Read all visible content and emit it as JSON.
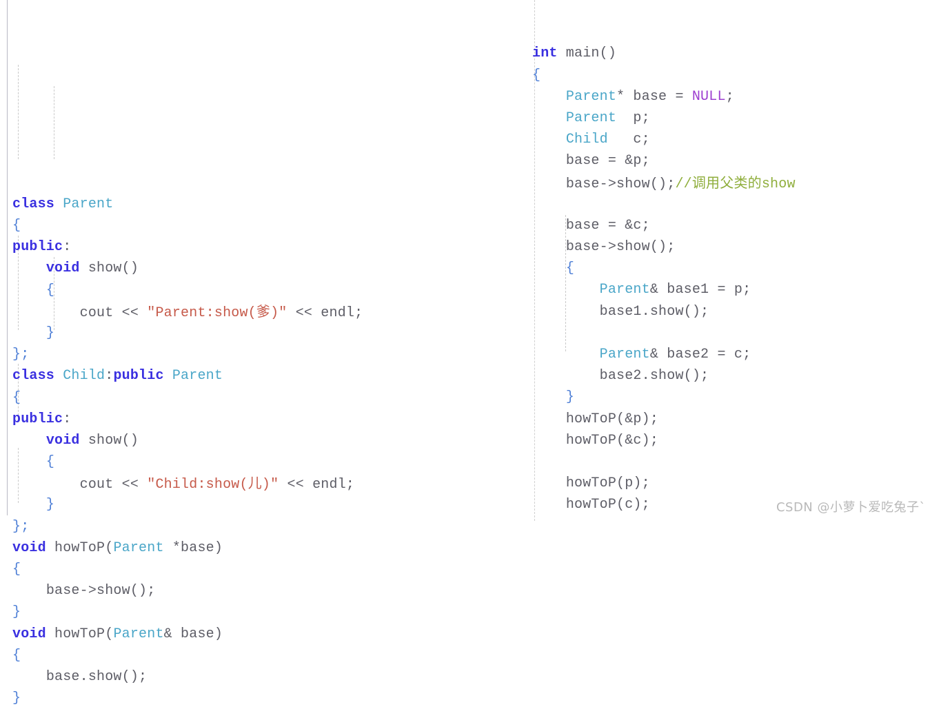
{
  "watermark": {
    "text": "CSDN @小萝卜爱吃兔子`"
  },
  "colors": {
    "background": "#ffffff",
    "keyword": "#3a30e0",
    "type": "#4aa6c8",
    "plain": "#5d5d66",
    "string": "#c65a4a",
    "comment": "#8fae3c",
    "macro": "#9d3fd0",
    "brace": "#4e7fd6",
    "guide": "#c9c9c9",
    "watermark": "#b9b9b9"
  },
  "left_pane": {
    "lines": [
      {
        "indent": 0,
        "tokens": [
          {
            "t": "class",
            "c": "kw"
          },
          {
            "t": " ",
            "c": "plain"
          },
          {
            "t": "Parent",
            "c": "type"
          }
        ]
      },
      {
        "indent": 0,
        "tokens": [
          {
            "t": "{",
            "c": "brace"
          }
        ]
      },
      {
        "indent": 0,
        "tokens": [
          {
            "t": "public",
            "c": "kw"
          },
          {
            "t": ":",
            "c": "plain"
          }
        ]
      },
      {
        "indent": 1,
        "tokens": [
          {
            "t": "void",
            "c": "kw"
          },
          {
            "t": " show()",
            "c": "plain"
          }
        ]
      },
      {
        "indent": 1,
        "tokens": [
          {
            "t": "{",
            "c": "brace"
          }
        ]
      },
      {
        "indent": 2,
        "tokens": [
          {
            "t": "cout << ",
            "c": "plain"
          },
          {
            "t": "\"Parent:show(",
            "c": "str"
          },
          {
            "t": "爹",
            "c": "str-cjk"
          },
          {
            "t": ")\"",
            "c": "str"
          },
          {
            "t": " << endl;",
            "c": "plain"
          }
        ]
      },
      {
        "indent": 1,
        "tokens": [
          {
            "t": "}",
            "c": "brace"
          }
        ]
      },
      {
        "indent": 0,
        "tokens": [
          {
            "t": "};",
            "c": "brace"
          }
        ]
      },
      {
        "indent": 0,
        "tokens": [
          {
            "t": "class",
            "c": "kw"
          },
          {
            "t": " ",
            "c": "plain"
          },
          {
            "t": "Child",
            "c": "type"
          },
          {
            "t": ":",
            "c": "plain"
          },
          {
            "t": "public",
            "c": "kw"
          },
          {
            "t": " ",
            "c": "plain"
          },
          {
            "t": "Parent",
            "c": "type"
          }
        ]
      },
      {
        "indent": 0,
        "tokens": [
          {
            "t": "{",
            "c": "brace"
          }
        ]
      },
      {
        "indent": 0,
        "tokens": [
          {
            "t": "public",
            "c": "kw"
          },
          {
            "t": ":",
            "c": "plain"
          }
        ]
      },
      {
        "indent": 1,
        "tokens": [
          {
            "t": "void",
            "c": "kw"
          },
          {
            "t": " show()",
            "c": "plain"
          }
        ]
      },
      {
        "indent": 1,
        "tokens": [
          {
            "t": "{",
            "c": "brace"
          }
        ]
      },
      {
        "indent": 2,
        "tokens": [
          {
            "t": "cout << ",
            "c": "plain"
          },
          {
            "t": "\"Child:show(",
            "c": "str"
          },
          {
            "t": "儿",
            "c": "str-cjk"
          },
          {
            "t": ")\"",
            "c": "str"
          },
          {
            "t": " << endl;",
            "c": "plain"
          }
        ]
      },
      {
        "indent": 1,
        "tokens": [
          {
            "t": "}",
            "c": "brace"
          }
        ]
      },
      {
        "indent": 0,
        "tokens": [
          {
            "t": "};",
            "c": "brace"
          }
        ]
      },
      {
        "indent": 0,
        "tokens": [
          {
            "t": "void",
            "c": "kw"
          },
          {
            "t": " howToP(",
            "c": "plain"
          },
          {
            "t": "Parent",
            "c": "type"
          },
          {
            "t": " *base)",
            "c": "plain"
          }
        ]
      },
      {
        "indent": 0,
        "tokens": [
          {
            "t": "{",
            "c": "brace"
          }
        ]
      },
      {
        "indent": 1,
        "tokens": [
          {
            "t": "base->show();",
            "c": "plain"
          }
        ]
      },
      {
        "indent": 0,
        "tokens": [
          {
            "t": "}",
            "c": "brace"
          }
        ]
      },
      {
        "indent": 0,
        "tokens": [
          {
            "t": "void",
            "c": "kw"
          },
          {
            "t": " howToP(",
            "c": "plain"
          },
          {
            "t": "Parent",
            "c": "type"
          },
          {
            "t": "& base)",
            "c": "plain"
          }
        ]
      },
      {
        "indent": 0,
        "tokens": [
          {
            "t": "{",
            "c": "brace"
          }
        ]
      },
      {
        "indent": 1,
        "tokens": [
          {
            "t": "base.show();",
            "c": "plain"
          }
        ]
      },
      {
        "indent": 0,
        "tokens": [
          {
            "t": "}",
            "c": "brace"
          }
        ]
      }
    ]
  },
  "right_pane": {
    "lines": [
      {
        "indent": 0,
        "tokens": [
          {
            "t": "int",
            "c": "kw"
          },
          {
            "t": " main()",
            "c": "plain"
          }
        ]
      },
      {
        "indent": 0,
        "tokens": [
          {
            "t": "{",
            "c": "brace"
          }
        ]
      },
      {
        "indent": 1,
        "tokens": [
          {
            "t": "Parent",
            "c": "type"
          },
          {
            "t": "* base = ",
            "c": "plain"
          },
          {
            "t": "NULL",
            "c": "macro"
          },
          {
            "t": ";",
            "c": "plain"
          }
        ]
      },
      {
        "indent": 1,
        "tokens": [
          {
            "t": "Parent",
            "c": "type"
          },
          {
            "t": "  p;",
            "c": "plain"
          }
        ]
      },
      {
        "indent": 1,
        "tokens": [
          {
            "t": "Child",
            "c": "type"
          },
          {
            "t": "   c;",
            "c": "plain"
          }
        ]
      },
      {
        "indent": 1,
        "tokens": [
          {
            "t": "base = &p;",
            "c": "plain"
          }
        ]
      },
      {
        "indent": 1,
        "tokens": [
          {
            "t": "base->show();",
            "c": "plain"
          },
          {
            "t": "//",
            "c": "cmt"
          },
          {
            "t": "调用父类的",
            "c": "cmt-cjk"
          },
          {
            "t": "show",
            "c": "cmt"
          }
        ]
      },
      {
        "indent": 1,
        "tokens": []
      },
      {
        "indent": 1,
        "tokens": [
          {
            "t": "base = &c;",
            "c": "plain"
          }
        ]
      },
      {
        "indent": 1,
        "tokens": [
          {
            "t": "base->show();",
            "c": "plain"
          }
        ]
      },
      {
        "indent": 1,
        "tokens": [
          {
            "t": "{",
            "c": "brace"
          }
        ]
      },
      {
        "indent": 2,
        "tokens": [
          {
            "t": "Parent",
            "c": "type"
          },
          {
            "t": "& base1 = p;",
            "c": "plain"
          }
        ]
      },
      {
        "indent": 2,
        "tokens": [
          {
            "t": "base1.show();",
            "c": "plain"
          }
        ]
      },
      {
        "indent": 2,
        "tokens": []
      },
      {
        "indent": 2,
        "tokens": [
          {
            "t": "Parent",
            "c": "type"
          },
          {
            "t": "& base2 = c;",
            "c": "plain"
          }
        ]
      },
      {
        "indent": 2,
        "tokens": [
          {
            "t": "base2.show();",
            "c": "plain"
          }
        ]
      },
      {
        "indent": 1,
        "tokens": [
          {
            "t": "}",
            "c": "brace"
          }
        ]
      },
      {
        "indent": 1,
        "tokens": [
          {
            "t": "howToP(&p);",
            "c": "plain"
          }
        ]
      },
      {
        "indent": 1,
        "tokens": [
          {
            "t": "howToP(&c);",
            "c": "plain"
          }
        ]
      },
      {
        "indent": 1,
        "tokens": []
      },
      {
        "indent": 1,
        "tokens": [
          {
            "t": "howToP(p);",
            "c": "plain"
          }
        ]
      },
      {
        "indent": 1,
        "tokens": [
          {
            "t": "howToP(c);",
            "c": "plain"
          }
        ]
      }
    ]
  }
}
